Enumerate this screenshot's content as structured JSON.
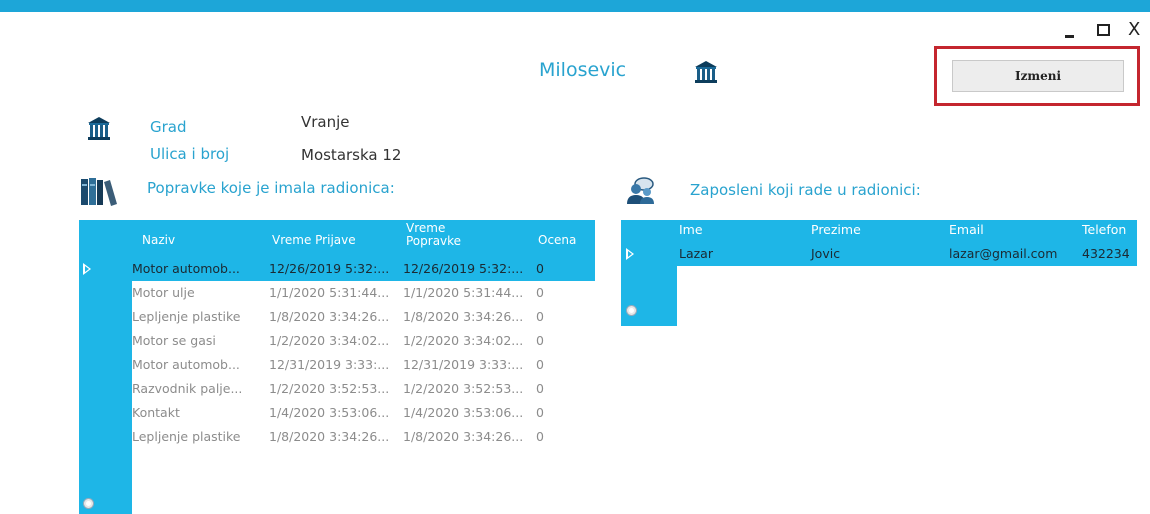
{
  "window": {
    "minimize_label": "",
    "close_label": "X"
  },
  "header": {
    "title": "Milosevic",
    "edit_button": "Izmeni"
  },
  "address": {
    "city_label": "Grad",
    "city_value": "Vranje",
    "street_label": "Ulica i broj",
    "street_value": "Mostarska 12"
  },
  "repairs": {
    "section_title": "Popravke koje je imala radionica:",
    "columns": [
      "Naziv",
      "Vreme Prijave",
      "Vreme Popravke",
      "Ocena"
    ],
    "rows": [
      [
        "Motor automob...",
        "12/26/2019 5:32:...",
        "12/26/2019 5:32:...",
        "0"
      ],
      [
        "Motor ulje",
        "1/1/2020 5:31:44...",
        "1/1/2020 5:31:44...",
        "0"
      ],
      [
        "Lepljenje plastike",
        "1/8/2020 3:34:26...",
        "1/8/2020 3:34:26...",
        "0"
      ],
      [
        "Motor se gasi",
        "1/2/2020 3:34:02...",
        "1/2/2020 3:34:02...",
        "0"
      ],
      [
        "Motor automob...",
        "12/31/2019 3:33:...",
        "12/31/2019 3:33:...",
        "0"
      ],
      [
        "Razvodnik palje...",
        "1/2/2020 3:52:53...",
        "1/2/2020 3:52:53...",
        "0"
      ],
      [
        "Kontakt",
        "1/4/2020 3:53:06...",
        "1/4/2020 3:53:06...",
        "0"
      ],
      [
        "Lepljenje plastike",
        "1/8/2020 3:34:26...",
        "1/8/2020 3:34:26...",
        "0"
      ]
    ]
  },
  "employees": {
    "section_title": "Zaposleni koji rade u radionici:",
    "columns": [
      "Ime",
      "Prezime",
      "Email",
      "Telefon"
    ],
    "rows": [
      [
        "Lazar",
        "Jovic",
        "lazar@gmail.com",
        "432234"
      ]
    ]
  },
  "colors": {
    "accent": "#1eb6e7",
    "title_text": "#29a3cf",
    "highlight_frame": "#c4262e"
  },
  "icons": {
    "title": "bank-icon",
    "city": "bank-icon",
    "repairs": "books-icon",
    "employees": "people-icon"
  }
}
